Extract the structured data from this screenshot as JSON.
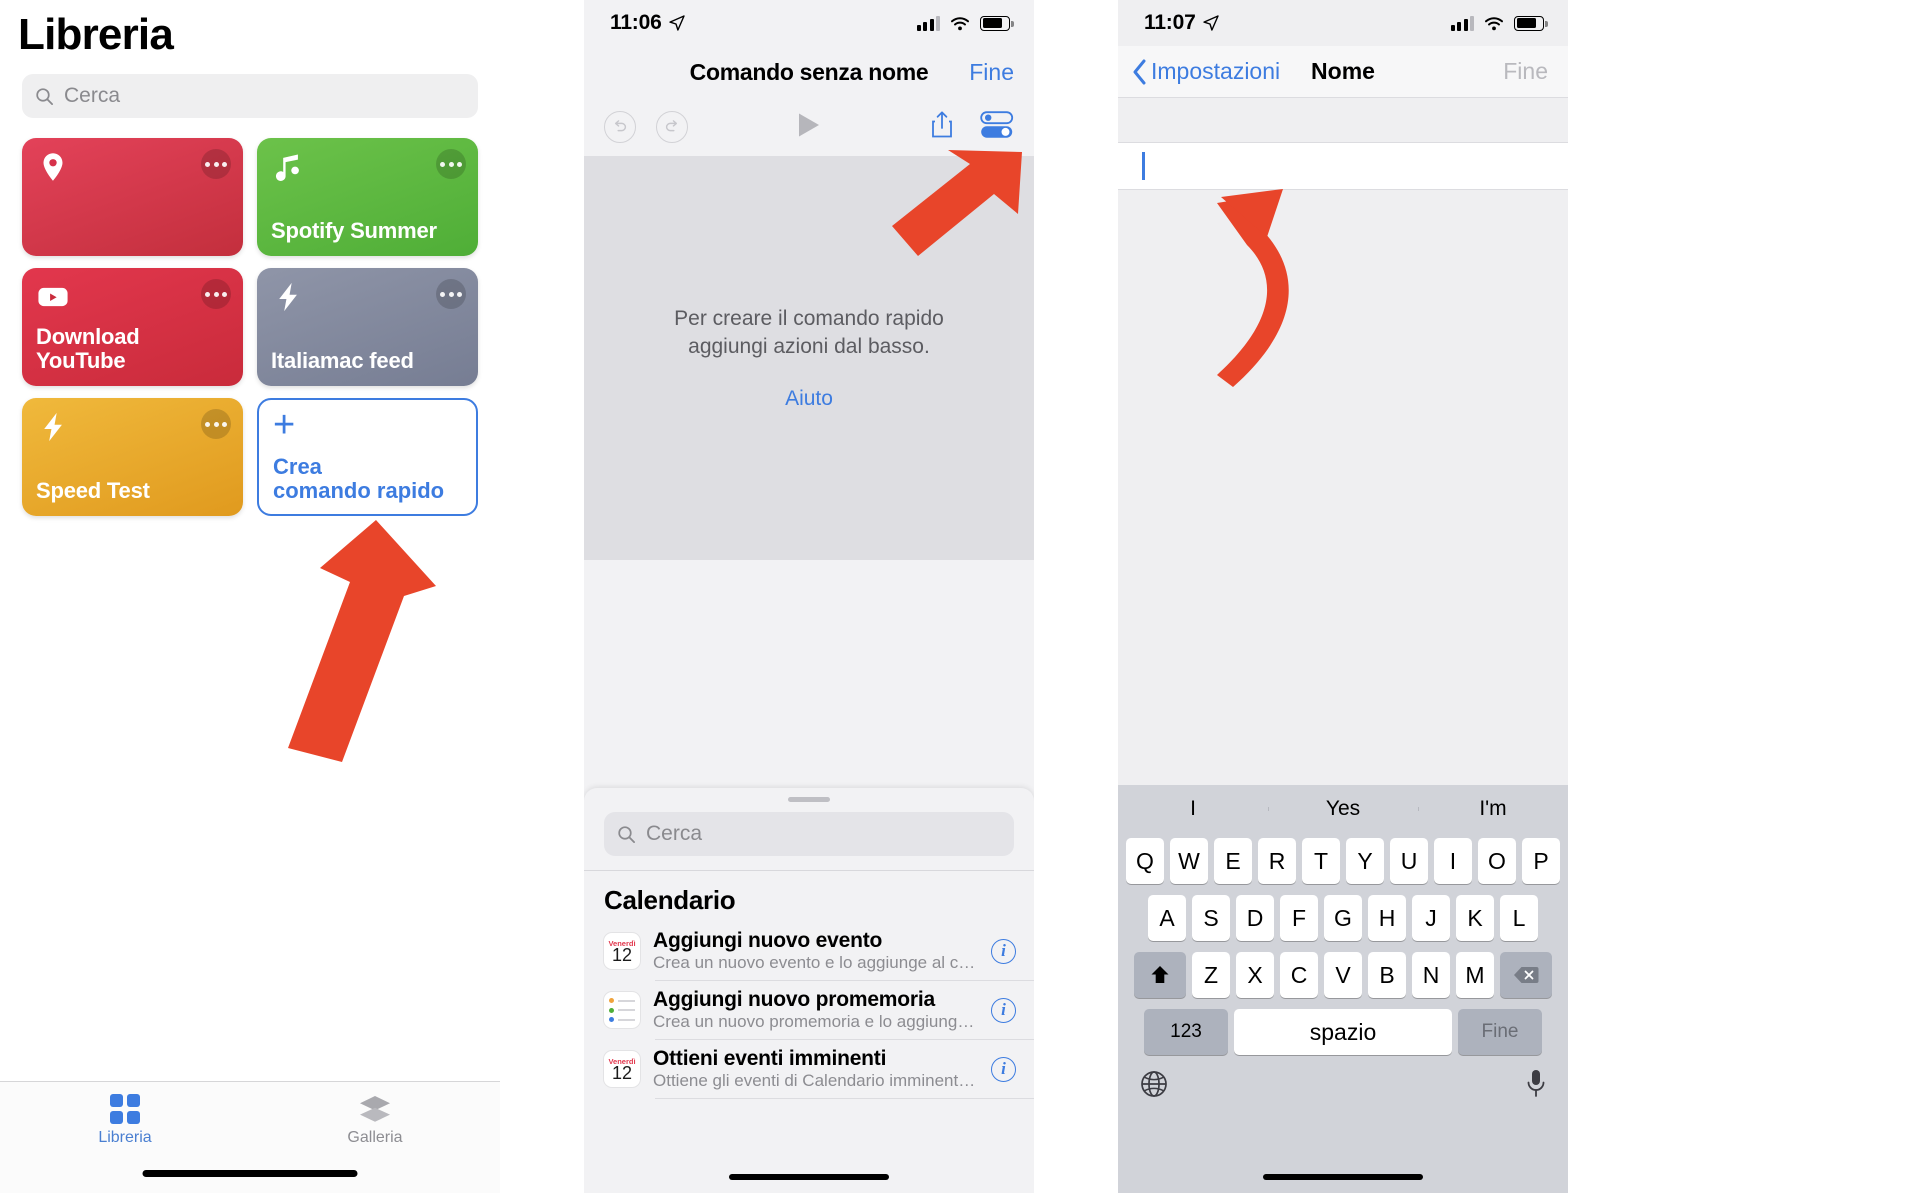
{
  "library": {
    "status": {
      "time": "",
      "icons": []
    },
    "title": "Libreria",
    "search_placeholder": "Cerca",
    "tiles": [
      {
        "name": "",
        "icon": "location-pin-icon",
        "color": "#d6314a",
        "style": "t-red"
      },
      {
        "name": "Spotify Summer",
        "icon": "music-note-icon",
        "color": "#5cb947",
        "style": "t-green"
      },
      {
        "name": "Download YouTube",
        "icon": "youtube-icon",
        "color": "#d6314a",
        "style": "t-red2"
      },
      {
        "name": "Italiamac feed",
        "icon": "bolt-icon",
        "color": "#838a9e",
        "style": "t-gray"
      },
      {
        "name": "Speed Test",
        "icon": "bolt-icon",
        "color": "#e9a92c",
        "style": "t-orange"
      }
    ],
    "create_tile": {
      "label_line1": "Crea",
      "label_line2": "comando rapido",
      "icon": "plus-icon",
      "color": "#3d7ce0"
    },
    "tabs": [
      {
        "label": "Libreria",
        "icon": "grid-icon",
        "selected": true
      },
      {
        "label": "Galleria",
        "icon": "layers-icon",
        "selected": false
      }
    ]
  },
  "editor": {
    "status": {
      "time": "11:06",
      "location_icon": "location-arrow-icon",
      "signal": "cellular-icon",
      "wifi": "wifi-icon",
      "battery": "battery-icon"
    },
    "nav": {
      "title": "Comando senza nome",
      "done": "Fine"
    },
    "toolbar": {
      "undo": "undo-icon",
      "redo": "redo-icon",
      "play": "play-icon",
      "share": "share-icon",
      "settings": "toggles-icon"
    },
    "empty_state": {
      "line1": "Per creare il comando rapido",
      "line2": "aggiungi azioni dal basso.",
      "help": "Aiuto"
    },
    "sheet": {
      "search_placeholder": "Cerca",
      "section_title": "Calendario",
      "actions": [
        {
          "title": "Aggiungi nuovo evento",
          "subtitle": "Crea un nuovo evento e lo aggiunge al cale...",
          "icon": "calendar-icon",
          "cal_weekday": "Venerdì",
          "cal_day": "12",
          "info": "i"
        },
        {
          "title": "Aggiungi nuovo promemoria",
          "subtitle": "Crea un nuovo promemoria e lo aggiunge a...",
          "icon": "reminders-icon",
          "cal_weekday": "",
          "cal_day": "",
          "info": "i"
        },
        {
          "title": "Ottieni eventi imminenti",
          "subtitle": "Ottiene gli eventi di Calendario imminenti d...",
          "icon": "calendar-icon",
          "cal_weekday": "Venerdì",
          "cal_day": "12",
          "info": "i"
        }
      ]
    }
  },
  "name_screen": {
    "status": {
      "time": "11:07",
      "location_icon": "location-arrow-icon"
    },
    "nav": {
      "back": "Impostazioni",
      "title": "Nome",
      "done": "Fine"
    },
    "field_value": "",
    "keyboard": {
      "predictions": [
        "I",
        "Yes",
        "I'm"
      ],
      "row1": [
        "Q",
        "W",
        "E",
        "R",
        "T",
        "Y",
        "U",
        "I",
        "O",
        "P"
      ],
      "row2": [
        "A",
        "S",
        "D",
        "F",
        "G",
        "H",
        "J",
        "K",
        "L"
      ],
      "row3": [
        "Z",
        "X",
        "C",
        "V",
        "B",
        "N",
        "M"
      ],
      "shift": "shift-icon",
      "backspace": "backspace-icon",
      "numbers": "123",
      "space": "spazio",
      "return": "Fine",
      "globe": "globe-icon",
      "mic": "microphone-icon"
    }
  },
  "annotations": {
    "arrow_color": "#e8452a",
    "arrows": [
      {
        "name": "arrow-to-create-shortcut"
      },
      {
        "name": "arrow-to-settings-toggle"
      },
      {
        "name": "arrow-to-name-field"
      }
    ]
  }
}
